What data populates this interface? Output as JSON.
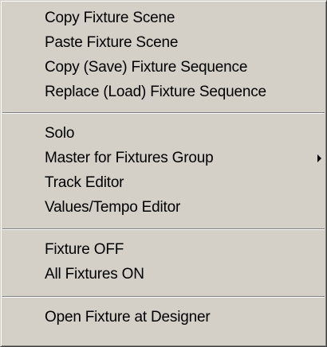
{
  "menu": {
    "groups": [
      {
        "items": [
          {
            "label": "Copy Fixture Scene"
          },
          {
            "label": "Paste Fixture Scene"
          },
          {
            "label": "Copy (Save) Fixture Sequence"
          },
          {
            "label": "Replace (Load) Fixture Sequence"
          }
        ]
      },
      {
        "items": [
          {
            "label": "Solo"
          },
          {
            "label": "Master for Fixtures Group",
            "submenu": true
          },
          {
            "label": "Track Editor"
          },
          {
            "label": "Values/Tempo Editor"
          }
        ]
      },
      {
        "items": [
          {
            "label": "Fixture OFF"
          },
          {
            "label": "All Fixtures ON"
          }
        ]
      },
      {
        "items": [
          {
            "label": "Open Fixture at Designer"
          }
        ]
      }
    ]
  }
}
